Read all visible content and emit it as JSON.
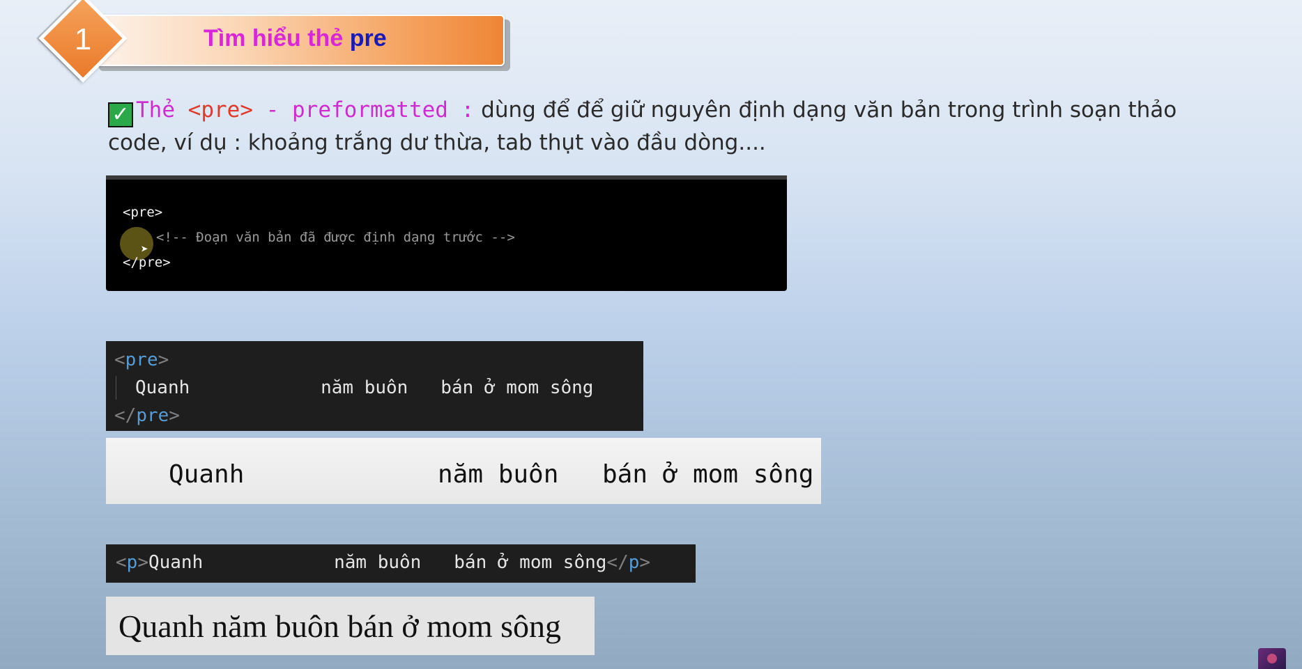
{
  "header": {
    "number": "1",
    "title_main": "Tìm hiểu thẻ",
    "title_accent": "pre"
  },
  "description": {
    "label_the": "Thẻ",
    "label_tag": "<pre>",
    "label_dash": "- preformatted :",
    "text": "dùng để để giữ nguyên định dạng văn bản trong trình soạn thảo code, ví dụ : khoảng trắng dư thừa, tab thụt vào đầu dòng...."
  },
  "code_block_1": {
    "line1": "<pre>",
    "line2": "<!-- Đoạn văn bản đã được định dạng trước -->",
    "line3": "</pre>"
  },
  "code_block_2": {
    "open_lt": "<",
    "open_name": "pre",
    "open_gt": ">",
    "content": "Quanh            năm buôn   bán ở mom sông",
    "close_lt": "</",
    "close_name": "pre",
    "close_gt": ">"
  },
  "render_pre": {
    "part1": "Quanh",
    "part2": "năm buôn",
    "part3": "bán ở mom sông"
  },
  "code_block_3": {
    "open_lt": "<",
    "open_name": "p",
    "open_gt": ">",
    "content": "Quanh            năm buôn   bán ở mom sông",
    "close_lt": "</",
    "close_name": "p",
    "close_gt": ">"
  },
  "render_p": {
    "text": "Quanh năm buôn bán ở mom sông"
  },
  "colors": {
    "title_main": "#d826d8",
    "title_accent": "#1a1ab6",
    "badge": "#f0883a",
    "check": "#2aa84a",
    "tag_name": "#569cd6"
  },
  "icons": {
    "check": "check-icon",
    "cursor": "cursor-icon"
  }
}
